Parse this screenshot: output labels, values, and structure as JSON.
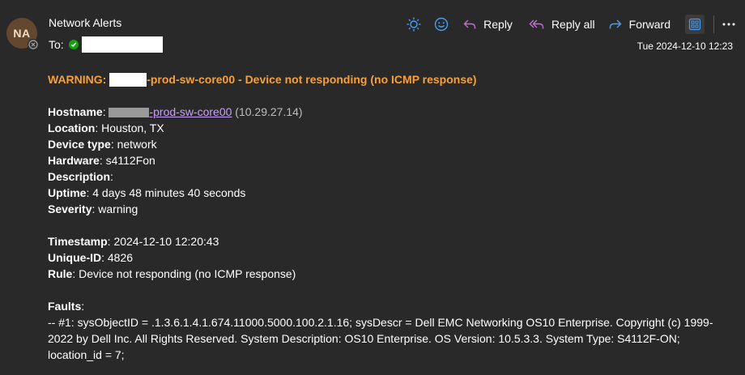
{
  "header": {
    "avatar_initials": "NA",
    "sender": "Network Alerts",
    "to_label": "To:",
    "date": "Tue 2024-12-10 12:23"
  },
  "toolbar": {
    "reply": "Reply",
    "reply_all": "Reply all",
    "forward": "Forward"
  },
  "colors": {
    "background": "#292929",
    "warning": "#f7a03a",
    "link": "#c6a0f6",
    "accent": "#479ef5",
    "reply_all": "#c06fd1"
  },
  "email": {
    "subject_prefix": "WARNING: ",
    "subject_suffix": "-prod-sw-core00 - Device not responding (no ICMP response)",
    "hostname_label": "Hostname",
    "hostname_suffix": "-prod-sw-core00",
    "hostname_ip": "(10.29.27.14)",
    "location_label": "Location",
    "location": "Houston, TX",
    "device_type_label": "Device type",
    "device_type": "network",
    "hardware_label": "Hardware",
    "hardware": "s4112Fon",
    "description_label": "Description",
    "uptime_label": "Uptime",
    "uptime": "4 days 48 minutes 40 seconds",
    "severity_label": "Severity",
    "severity": "warning",
    "timestamp_label": "Timestamp",
    "timestamp": "2024-12-10 12:20:43",
    "unique_id_label": "Unique-ID",
    "unique_id": "4826",
    "rule_label": "Rule",
    "rule": "Device not responding (no ICMP response)",
    "faults_label": "Faults",
    "faults_text": "-- #1: sysObjectID = .1.3.6.1.4.1.674.11000.5000.100.2.1.16; sysDescr = Dell EMC Networking OS10 Enterprise. Copyright (c) 1999-2022 by Dell Inc. All Rights Reserved. System Description: OS10 Enterprise. OS Version: 10.5.3.3. System Type: S4112F-ON; location_id = 7;"
  },
  "icons": [
    "brightness-icon",
    "emoji-icon",
    "reply-icon",
    "reply-all-icon",
    "forward-icon",
    "apps-icon",
    "more-icon",
    "presence-icon",
    "verified-check-icon"
  ]
}
